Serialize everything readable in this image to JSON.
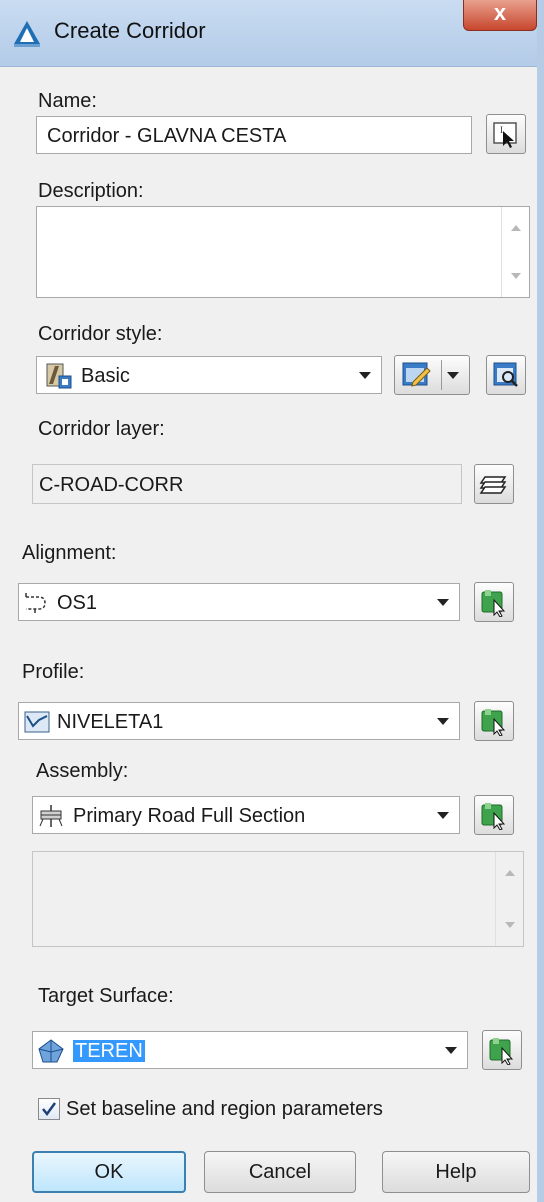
{
  "window": {
    "title": "Create Corridor",
    "close_label": "x"
  },
  "name": {
    "label": "Name:",
    "value": "Corridor - GLAVNA CESTA"
  },
  "description": {
    "label": "Description:",
    "value": ""
  },
  "corridor_style": {
    "label": "Corridor style:",
    "value": "Basic"
  },
  "corridor_layer": {
    "label": "Corridor layer:",
    "value": "C-ROAD-CORR"
  },
  "alignment": {
    "label": "Alignment:",
    "value": "OS1"
  },
  "profile": {
    "label": "Profile:",
    "value": "NIVELETA1"
  },
  "assembly": {
    "label": "Assembly:",
    "value": "Primary Road Full Section"
  },
  "target_surface": {
    "label": "Target Surface:",
    "value": "TEREN"
  },
  "baseline": {
    "label": "Set baseline and region parameters",
    "checked": true
  },
  "buttons": {
    "ok": "OK",
    "cancel": "Cancel",
    "help": "Help"
  },
  "colors": {
    "titlebar": "#b3cbe8",
    "close": "#c8462e",
    "selection": "#3399ff",
    "pick_icon": "#3fa34d"
  },
  "icons": [
    "autocad-icon",
    "close-icon",
    "pick-name-icon",
    "style-icon",
    "edit-style-icon",
    "style-detail-icon",
    "layer-icon",
    "alignment-icon",
    "profile-icon",
    "assembly-icon",
    "surface-icon",
    "pick-from-drawing-icon",
    "check-icon"
  ]
}
